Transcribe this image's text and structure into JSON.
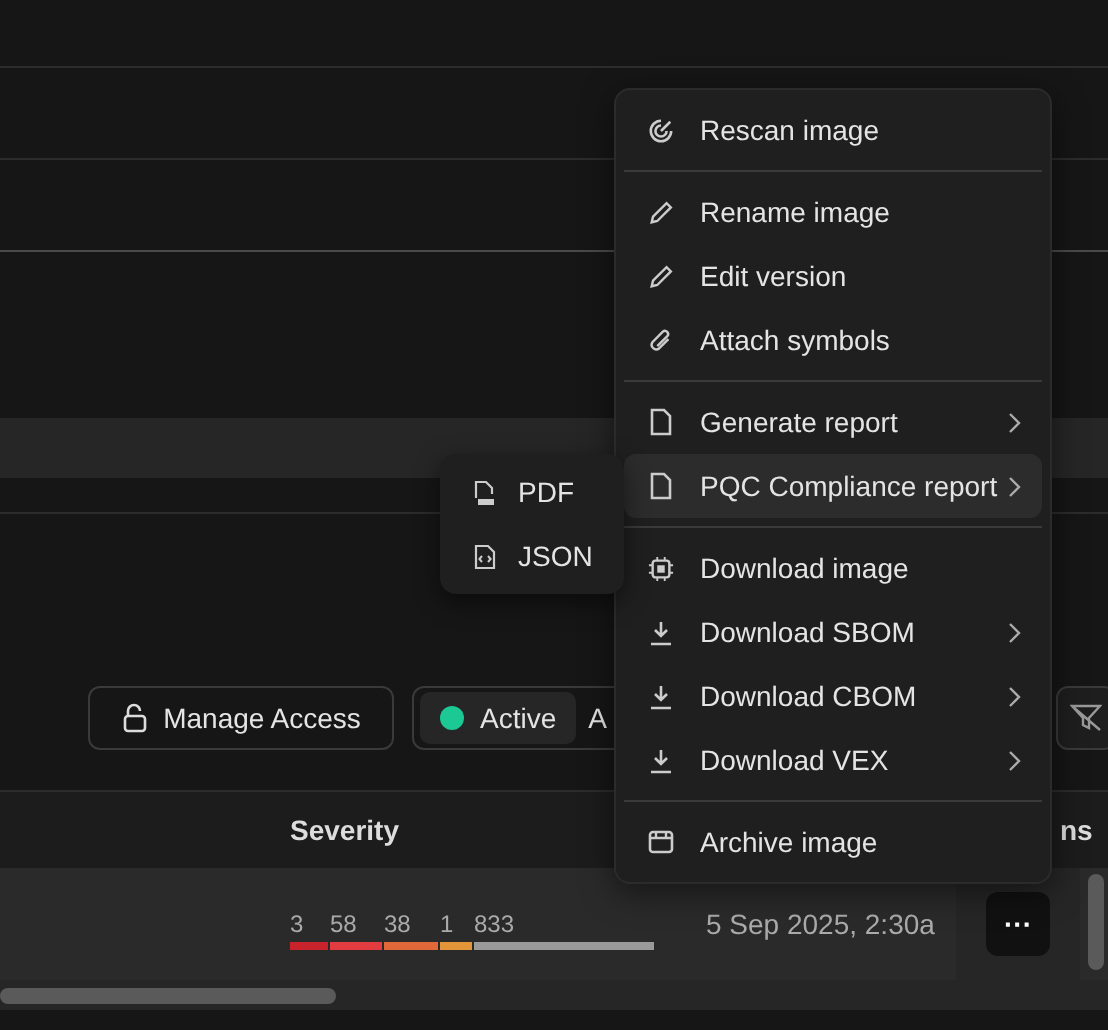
{
  "toolbar": {
    "manage_access": "Manage Access",
    "status_options": [
      {
        "label": "Active",
        "selected": true,
        "color": "#1cc893"
      },
      {
        "label": "A",
        "selected": false
      }
    ]
  },
  "table": {
    "columns": [
      "Severity",
      "ns"
    ],
    "rows": [
      {
        "severity": [
          {
            "count": "3",
            "color": "#c9242c"
          },
          {
            "count": "58",
            "color": "#e23b40"
          },
          {
            "count": "38",
            "color": "#e2683a"
          },
          {
            "count": "1",
            "color": "#e3953a"
          },
          {
            "count": "833",
            "color": "#9a9a9a"
          }
        ],
        "date": "5 Sep 2025, 2:30a",
        "actions": "···"
      }
    ]
  },
  "menu": {
    "groups": [
      {
        "items": [
          {
            "label": "Rescan image",
            "kind": "rescan",
            "submenu": false,
            "selected": false
          }
        ]
      },
      {
        "items": [
          {
            "label": "Rename image",
            "kind": "pencil",
            "submenu": false,
            "selected": false
          },
          {
            "label": "Edit version",
            "kind": "pencil",
            "submenu": false,
            "selected": false
          },
          {
            "label": "Attach symbols",
            "kind": "clip",
            "submenu": false,
            "selected": false
          }
        ]
      },
      {
        "items": [
          {
            "label": "Generate report",
            "kind": "file",
            "submenu": true,
            "selected": false
          },
          {
            "label": "PQC Compliance report",
            "kind": "file",
            "submenu": true,
            "selected": true
          }
        ]
      },
      {
        "items": [
          {
            "label": "Download image",
            "kind": "chip",
            "submenu": false,
            "selected": false
          },
          {
            "label": "Download SBOM",
            "kind": "download",
            "submenu": true,
            "selected": false
          },
          {
            "label": "Download CBOM",
            "kind": "download",
            "submenu": true,
            "selected": false
          },
          {
            "label": "Download VEX",
            "kind": "download",
            "submenu": true,
            "selected": false
          }
        ]
      },
      {
        "items": [
          {
            "label": "Archive image",
            "kind": "archive",
            "submenu": false,
            "selected": false
          }
        ]
      }
    ]
  },
  "submenu": {
    "items": [
      {
        "label": "PDF",
        "kind": "pdf"
      },
      {
        "label": "JSON",
        "kind": "json"
      }
    ]
  }
}
